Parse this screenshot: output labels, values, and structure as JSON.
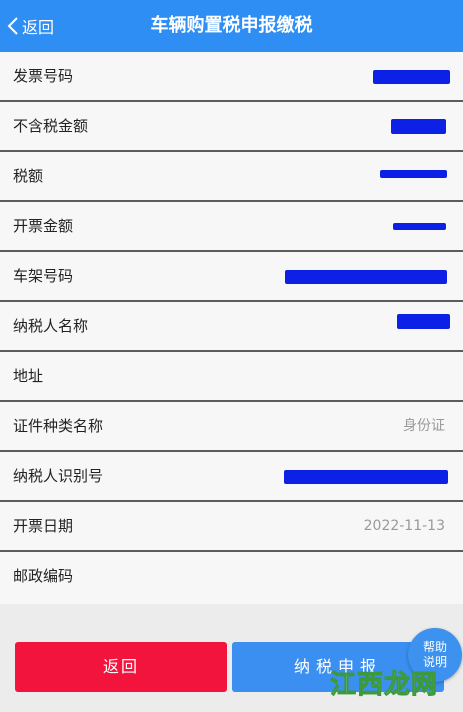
{
  "header": {
    "back_label": "返回",
    "title": "车辆购置税申报缴税"
  },
  "rows": [
    {
      "label": "发票号码",
      "value": ""
    },
    {
      "label": "不含税金额",
      "value": ""
    },
    {
      "label": "税额",
      "value": ""
    },
    {
      "label": "开票金额",
      "value": ""
    },
    {
      "label": "车架号码",
      "value": ""
    },
    {
      "label": "纳税人名称",
      "value": ""
    },
    {
      "label": "地址",
      "value": ""
    },
    {
      "label": "证件种类名称",
      "value": "身份证"
    },
    {
      "label": "纳税人识别号",
      "value": ""
    },
    {
      "label": "开票日期",
      "value": "2022-11-13"
    },
    {
      "label": "邮政编码",
      "value": ""
    }
  ],
  "footer": {
    "back_button": "返回",
    "submit_button": "纳税申报"
  },
  "help": {
    "line1": "帮助",
    "line2": "说明"
  },
  "watermark": {
    "text": "江西龙网"
  },
  "colors": {
    "header_bg": "#2f8ef4",
    "back_button_bg": "#f2143d",
    "submit_button_bg": "#3b8ff0",
    "redaction": "#0d21e6"
  }
}
